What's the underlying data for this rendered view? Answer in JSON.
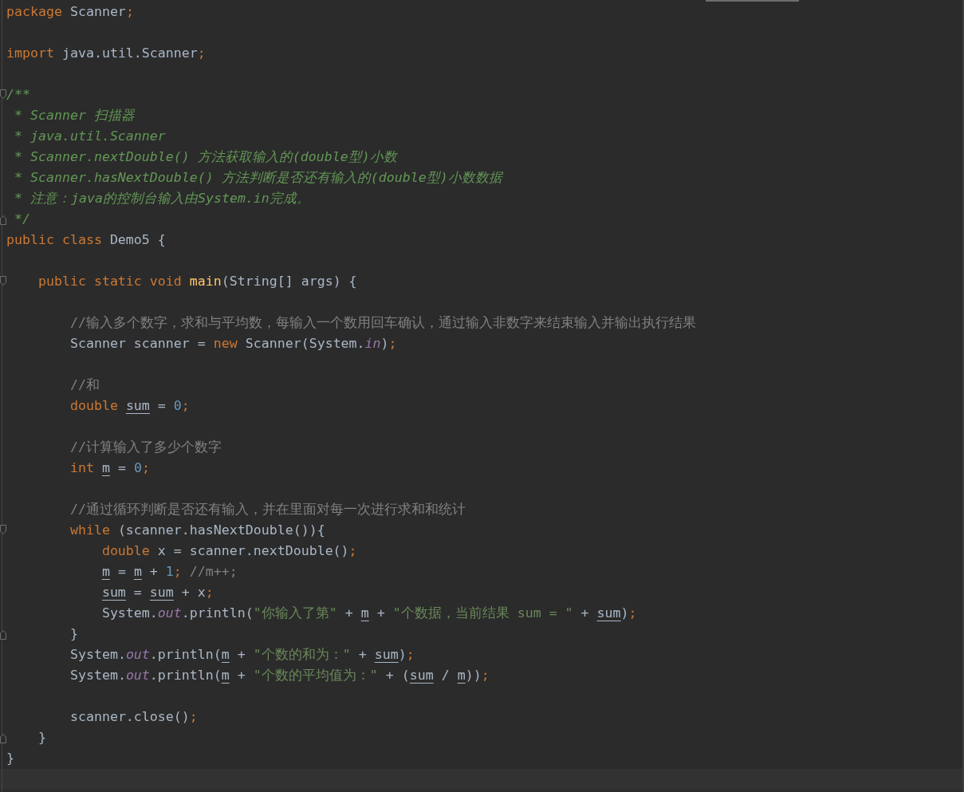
{
  "editor": {
    "current_line_highlight": true,
    "lines": [
      {
        "kind": "code",
        "tokens": [
          {
            "kind": "keyword",
            "text": "package"
          },
          {
            "kind": "plain",
            "text": " Scanner"
          },
          {
            "kind": "keyword",
            "text": ";"
          }
        ]
      },
      {
        "kind": "blank"
      },
      {
        "kind": "code",
        "tokens": [
          {
            "kind": "keyword",
            "text": "import"
          },
          {
            "kind": "plain",
            "text": " java.util.Scanner"
          },
          {
            "kind": "keyword",
            "text": ";"
          }
        ]
      },
      {
        "kind": "blank"
      },
      {
        "kind": "code",
        "fold": {
          "kind": "start"
        },
        "tokens": [
          {
            "kind": "doc",
            "text": "/**"
          }
        ]
      },
      {
        "kind": "code",
        "tokens": [
          {
            "kind": "doc",
            "text": " * Scanner 扫描器"
          }
        ]
      },
      {
        "kind": "code",
        "tokens": [
          {
            "kind": "doc",
            "text": " * java.util.Scanner"
          }
        ]
      },
      {
        "kind": "code",
        "tokens": [
          {
            "kind": "doc",
            "text": " * Scanner.nextDouble() 方法获取输入的(double型)小数"
          }
        ]
      },
      {
        "kind": "code",
        "tokens": [
          {
            "kind": "doc",
            "text": " * Scanner.hasNextDouble() 方法判断是否还有输入的(double型)小数数据"
          }
        ]
      },
      {
        "kind": "code",
        "tokens": [
          {
            "kind": "doc",
            "text": " * 注意：java的控制台输入由System.in完成。"
          }
        ]
      },
      {
        "kind": "code",
        "fold": {
          "kind": "end"
        },
        "tokens": [
          {
            "kind": "doc",
            "text": " */"
          }
        ]
      },
      {
        "kind": "code",
        "tokens": [
          {
            "kind": "keyword",
            "text": "public class"
          },
          {
            "kind": "plain",
            "text": " Demo5 {"
          }
        ]
      },
      {
        "kind": "blank"
      },
      {
        "kind": "code",
        "fold": {
          "kind": "start"
        },
        "tokens": [
          {
            "kind": "keyword",
            "text": "    public static void "
          },
          {
            "kind": "method",
            "text": "main"
          },
          {
            "kind": "plain",
            "text": "(String[] args) {"
          }
        ]
      },
      {
        "kind": "blank"
      },
      {
        "kind": "code",
        "tokens": [
          {
            "kind": "comment",
            "text": "        //输入多个数字，求和与平均数，每输入一个数用回车确认，通过输入非数字来结束输入并输出执行结果"
          }
        ]
      },
      {
        "kind": "code",
        "tokens": [
          {
            "kind": "plain",
            "text": "        Scanner scanner = "
          },
          {
            "kind": "keyword",
            "text": "new"
          },
          {
            "kind": "plain",
            "text": " Scanner(System."
          },
          {
            "kind": "field",
            "text": "in"
          },
          {
            "kind": "plain",
            "text": ")"
          },
          {
            "kind": "keyword",
            "text": ";"
          }
        ]
      },
      {
        "kind": "blank"
      },
      {
        "kind": "code",
        "tokens": [
          {
            "kind": "comment",
            "text": "        //和"
          }
        ]
      },
      {
        "kind": "code",
        "tokens": [
          {
            "kind": "keyword",
            "text": "        double "
          },
          {
            "kind": "var",
            "text": "sum"
          },
          {
            "kind": "plain",
            "text": " = "
          },
          {
            "kind": "number",
            "text": "0"
          },
          {
            "kind": "keyword",
            "text": ";"
          }
        ]
      },
      {
        "kind": "blank"
      },
      {
        "kind": "code",
        "tokens": [
          {
            "kind": "comment",
            "text": "        //计算输入了多少个数字"
          }
        ]
      },
      {
        "kind": "code",
        "tokens": [
          {
            "kind": "keyword",
            "text": "        int "
          },
          {
            "kind": "var",
            "text": "m"
          },
          {
            "kind": "plain",
            "text": " = "
          },
          {
            "kind": "number",
            "text": "0"
          },
          {
            "kind": "keyword",
            "text": ";"
          }
        ]
      },
      {
        "kind": "blank"
      },
      {
        "kind": "code",
        "tokens": [
          {
            "kind": "comment",
            "text": "        //通过循环判断是否还有输入，并在里面对每一次进行求和和统计"
          }
        ]
      },
      {
        "kind": "code",
        "fold": {
          "kind": "start"
        },
        "tokens": [
          {
            "kind": "keyword",
            "text": "        while"
          },
          {
            "kind": "plain",
            "text": " (scanner.hasNextDouble()){"
          }
        ]
      },
      {
        "kind": "code",
        "tokens": [
          {
            "kind": "keyword",
            "text": "            double"
          },
          {
            "kind": "plain",
            "text": " x = scanner.nextDouble()"
          },
          {
            "kind": "keyword",
            "text": ";"
          }
        ]
      },
      {
        "kind": "code",
        "tokens": [
          {
            "kind": "var",
            "text": "            m"
          },
          {
            "kind": "plain",
            "text": " = "
          },
          {
            "kind": "var",
            "text": "m"
          },
          {
            "kind": "plain",
            "text": " + "
          },
          {
            "kind": "number",
            "text": "1"
          },
          {
            "kind": "keyword",
            "text": ";"
          },
          {
            "kind": "comment",
            "text": " //m++;"
          }
        ]
      },
      {
        "kind": "code",
        "tokens": [
          {
            "kind": "var",
            "text": "            sum"
          },
          {
            "kind": "plain",
            "text": " = "
          },
          {
            "kind": "var",
            "text": "sum"
          },
          {
            "kind": "plain",
            "text": " + x"
          },
          {
            "kind": "keyword",
            "text": ";"
          }
        ]
      },
      {
        "kind": "code",
        "tokens": [
          {
            "kind": "plain",
            "text": "            System."
          },
          {
            "kind": "field",
            "text": "out"
          },
          {
            "kind": "plain",
            "text": ".println("
          },
          {
            "kind": "string",
            "text": "\"你输入了第\""
          },
          {
            "kind": "plain",
            "text": " + "
          },
          {
            "kind": "var",
            "text": "m"
          },
          {
            "kind": "plain",
            "text": " + "
          },
          {
            "kind": "string",
            "text": "\"个数据，当前结果 sum = \""
          },
          {
            "kind": "plain",
            "text": " + "
          },
          {
            "kind": "var",
            "text": "sum"
          },
          {
            "kind": "plain",
            "text": ")"
          },
          {
            "kind": "keyword",
            "text": ";"
          }
        ]
      },
      {
        "kind": "code",
        "fold": {
          "kind": "end"
        },
        "tokens": [
          {
            "kind": "plain",
            "text": "        }"
          }
        ]
      },
      {
        "kind": "code",
        "tokens": [
          {
            "kind": "plain",
            "text": "        System."
          },
          {
            "kind": "field",
            "text": "out"
          },
          {
            "kind": "plain",
            "text": ".println("
          },
          {
            "kind": "var",
            "text": "m"
          },
          {
            "kind": "plain",
            "text": " + "
          },
          {
            "kind": "string",
            "text": "\"个数的和为：\""
          },
          {
            "kind": "plain",
            "text": " + "
          },
          {
            "kind": "var",
            "text": "sum"
          },
          {
            "kind": "plain",
            "text": ")"
          },
          {
            "kind": "keyword",
            "text": ";"
          }
        ]
      },
      {
        "kind": "code",
        "tokens": [
          {
            "kind": "plain",
            "text": "        System."
          },
          {
            "kind": "field",
            "text": "out"
          },
          {
            "kind": "plain",
            "text": ".println("
          },
          {
            "kind": "var",
            "text": "m"
          },
          {
            "kind": "plain",
            "text": " + "
          },
          {
            "kind": "string",
            "text": "\"个数的平均值为：\""
          },
          {
            "kind": "plain",
            "text": " + ("
          },
          {
            "kind": "var",
            "text": "sum"
          },
          {
            "kind": "plain",
            "text": " / "
          },
          {
            "kind": "var",
            "text": "m"
          },
          {
            "kind": "plain",
            "text": "))"
          },
          {
            "kind": "keyword",
            "text": ";"
          }
        ]
      },
      {
        "kind": "blank"
      },
      {
        "kind": "code",
        "tokens": [
          {
            "kind": "plain",
            "text": "        scanner.close()"
          },
          {
            "kind": "keyword",
            "text": ";"
          }
        ]
      },
      {
        "kind": "code",
        "fold": {
          "kind": "end"
        },
        "tokens": [
          {
            "kind": "plain",
            "text": "    }"
          }
        ]
      },
      {
        "kind": "code",
        "tokens": [
          {
            "kind": "plain",
            "text": "}"
          }
        ]
      }
    ]
  }
}
